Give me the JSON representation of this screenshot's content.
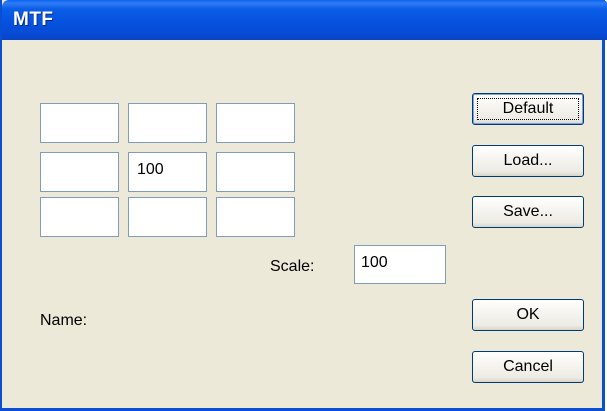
{
  "window": {
    "title": "MTF"
  },
  "matrix": {
    "cells": [
      [
        "",
        "",
        ""
      ],
      [
        "",
        "100",
        ""
      ],
      [
        "",
        "",
        ""
      ]
    ]
  },
  "scale": {
    "label": "Scale:",
    "value": "100"
  },
  "name": {
    "label": "Name:"
  },
  "buttons": {
    "default_label": "Default",
    "load_label": "Load...",
    "save_label": "Save...",
    "ok_label": "OK",
    "cancel_label": "Cancel"
  }
}
